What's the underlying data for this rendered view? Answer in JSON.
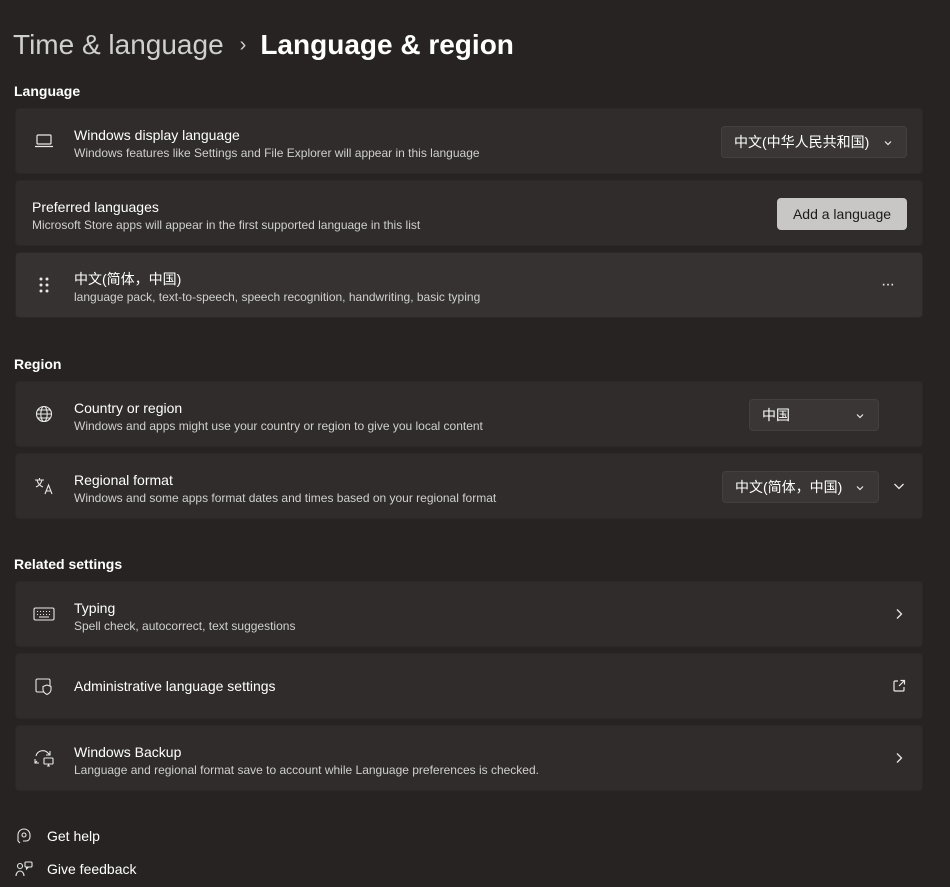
{
  "breadcrumb": {
    "parent": "Time & language",
    "separator": "›",
    "current": "Language & region"
  },
  "sections": {
    "language": "Language",
    "region": "Region",
    "related": "Related settings"
  },
  "display_language": {
    "title": "Windows display language",
    "desc": "Windows features like Settings and File Explorer will appear in this language",
    "value": "中文(中华人民共和国)",
    "icon": "laptop-icon"
  },
  "preferred_languages": {
    "title": "Preferred languages",
    "desc": "Microsoft Store apps will appear in the first supported language in this list",
    "button": "Add a language"
  },
  "language_item": {
    "title": "中文(简体，中国)",
    "desc": "language pack, text-to-speech, speech recognition, handwriting, basic typing",
    "more": "···"
  },
  "country": {
    "title": "Country or region",
    "desc": "Windows and apps might use your country or region to give you local content",
    "value": "中国",
    "icon": "globe-icon"
  },
  "regional_format": {
    "title": "Regional format",
    "desc": "Windows and some apps format dates and times based on your regional format",
    "value": "中文(简体，中国)",
    "icon": "regional-format-icon"
  },
  "typing": {
    "title": "Typing",
    "desc": "Spell check, autocorrect, text suggestions",
    "icon": "keyboard-icon"
  },
  "admin": {
    "title": "Administrative language settings",
    "icon": "shield-icon"
  },
  "backup": {
    "title": "Windows Backup",
    "desc": "Language and regional format save to account while Language preferences is checked.",
    "icon": "sync-icon"
  },
  "footer": {
    "help": "Get help",
    "feedback": "Give feedback"
  },
  "colors": {
    "background": "#272322",
    "card": "#302c2b",
    "button": "#c9c7c6"
  }
}
